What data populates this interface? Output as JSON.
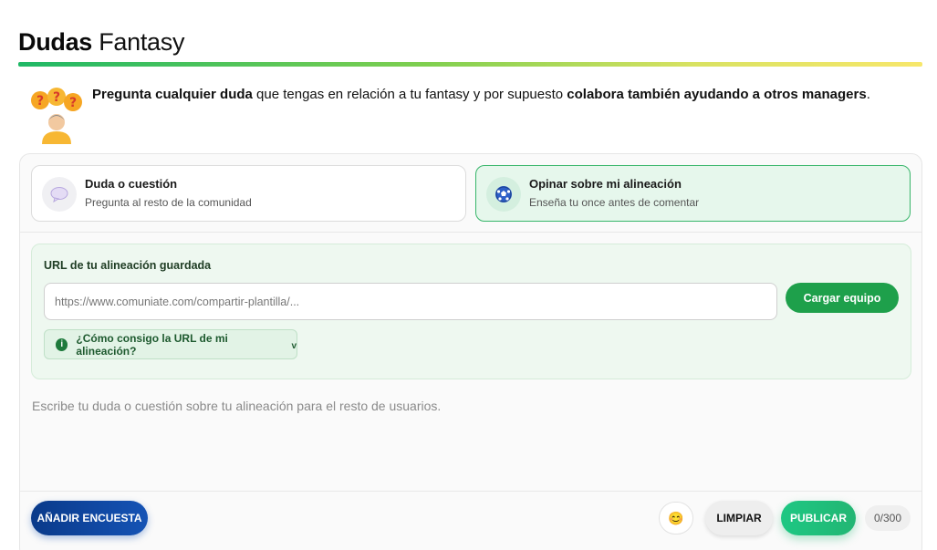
{
  "page": {
    "title_bold": "Dudas",
    "title_light": "Fantasy"
  },
  "intro": {
    "bold1": "Pregunta cualquier duda",
    "text1": " que tengas en relación a tu fantasy y por supuesto ",
    "bold2": "colabora también ayudando a otros managers",
    "text2": "."
  },
  "options": [
    {
      "title": "Duda o cuestión",
      "subtitle": "Pregunta al resto de la comunidad",
      "icon": "speech-bubble-icon",
      "selected": false
    },
    {
      "title": "Opinar sobre mi alineación",
      "subtitle": "Enseña tu once antes de comentar",
      "icon": "soccer-ball-icon",
      "selected": true
    }
  ],
  "url_panel": {
    "label": "URL de tu alineación guardada",
    "placeholder": "https://www.comuniate.com/compartir-plantilla/...",
    "value": "",
    "load_button": "Cargar equipo",
    "help_text": "¿Cómo consigo la URL de mi alineación?",
    "help_chevron": "v",
    "info_glyph": "i"
  },
  "question": {
    "placeholder": "Escribe tu duda o cuestión sobre tu alineación para el resto de usuarios.",
    "value": ""
  },
  "toolbar": {
    "poll_button": "AÑADIR ENCUESTA",
    "emoji_icon": "😊",
    "clear_button": "LIMPIAR",
    "publish_button": "PUBLICAR",
    "counter": "0/300"
  },
  "colors": {
    "accent_green": "#1ea04b",
    "poll_blue": "#0a3a8a",
    "publish_green": "#22b673",
    "selected_border": "#37b56a"
  }
}
